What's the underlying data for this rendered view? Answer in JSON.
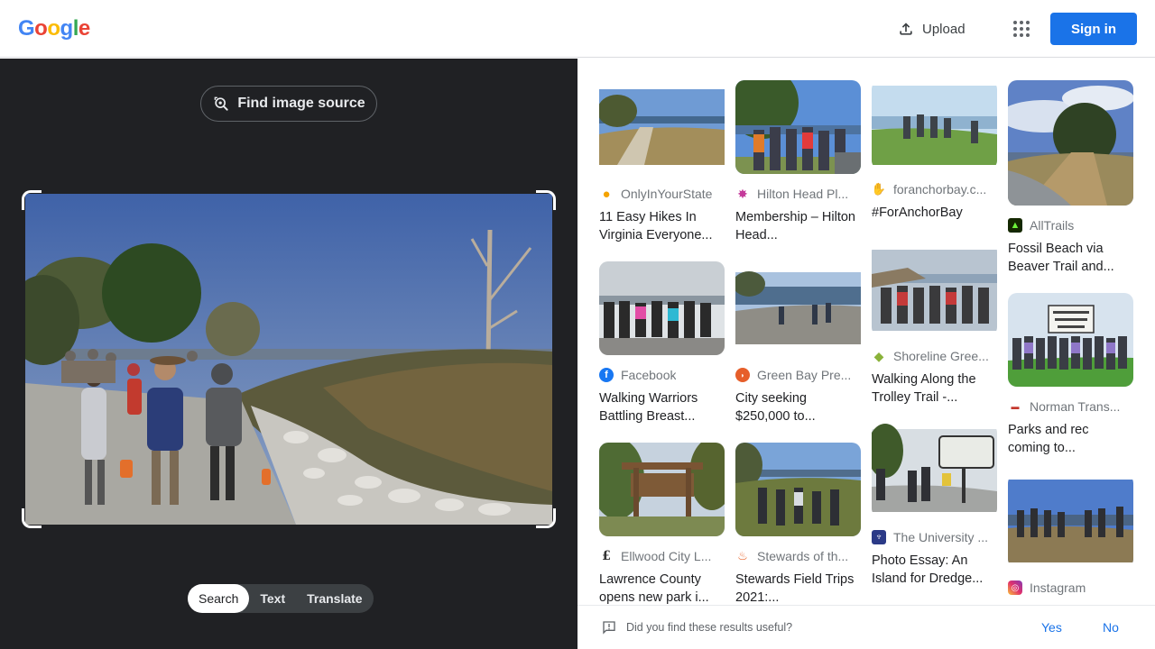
{
  "header": {
    "logo_letters": [
      "G",
      "o",
      "o",
      "g",
      "l",
      "e"
    ],
    "logo_colors": [
      "#4285f4",
      "#ea4335",
      "#fbbc05",
      "#4285f4",
      "#34a853",
      "#ea4335"
    ],
    "upload_label": "Upload",
    "signin_label": "Sign in"
  },
  "left": {
    "find_source_label": "Find image source",
    "tabs": [
      {
        "label": "Search",
        "active": true
      },
      {
        "label": "Text",
        "active": false
      },
      {
        "label": "Translate",
        "active": false
      }
    ]
  },
  "results": [
    {
      "source": "OnlyInYourState",
      "title": "11 Easy Hikes In Virginia Everyone...",
      "favicon": "pin-icon"
    },
    {
      "source": "Hilton Head Pl...",
      "title": "Membership – Hilton Head...",
      "favicon": "sunburst-icon"
    },
    {
      "source": "foranchorbay.c...",
      "title": "#ForAnchorBay",
      "favicon": "hand-icon"
    },
    {
      "source": "AllTrails",
      "title": "Fossil Beach via Beaver Trail and...",
      "favicon": "alltrails-icon"
    },
    {
      "source": "Facebook",
      "title": "Walking Warriors Battling Breast...",
      "favicon": "facebook-icon"
    },
    {
      "source": "Green Bay Pre...",
      "title": "City seeking $250,000 to...",
      "favicon": "greenbay-icon"
    },
    {
      "source": "Shoreline Gree...",
      "title": "Walking Along the Trolley Trail -...",
      "favicon": "diamond-icon"
    },
    {
      "source": "Norman Trans...",
      "title": "Parks and rec coming to...",
      "favicon": "norman-icon"
    },
    {
      "source": "Ellwood City L...",
      "title": "Lawrence County opens new park i...",
      "favicon": "gothic-e-icon"
    },
    {
      "source": "Stewards of th...",
      "title": "Stewards Field Trips 2021:...",
      "favicon": "flame-icon"
    },
    {
      "source": "The University ...",
      "title": "Photo Essay: An Island for Dredge...",
      "favicon": "university-icon"
    },
    {
      "source": "Instagram",
      "title": "",
      "favicon": "instagram-icon"
    }
  ],
  "feedback": {
    "question": "Did you find these results useful?",
    "yes_label": "Yes",
    "no_label": "No"
  },
  "colors": {
    "accent": "#1a73e8",
    "left_bg": "#202124"
  }
}
